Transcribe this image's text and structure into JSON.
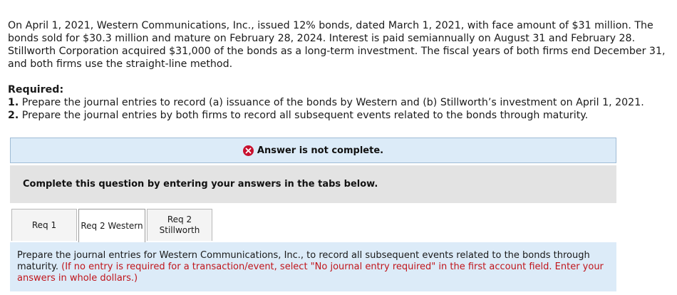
{
  "problem": {
    "text": "On April 1, 2021, Western Communications, Inc., issued 12% bonds, dated March 1, 2021, with face amount of $31 million. The bonds sold for $30.3 million and mature on February 28, 2024. Interest is paid semiannually on August 31 and February 28. Stillworth Corporation acquired $31,000 of the bonds as a long-term investment. The fiscal years of both firms end December 31, and both firms use the straight-line method."
  },
  "required": {
    "title": "Required:",
    "items": [
      {
        "num": "1.",
        "text": " Prepare the journal entries to record (a) issuance of the bonds by Western and (b) Stillworth’s investment on April 1, 2021."
      },
      {
        "num": "2.",
        "text": " Prepare the journal entries by both firms to record all subsequent events related to the bonds through maturity."
      }
    ]
  },
  "status": {
    "text": "Answer is not complete.",
    "icon": "x-circle-icon",
    "icon_color": "#c8102e"
  },
  "instruction": {
    "text": "Complete this question by entering your answers in the tabs below."
  },
  "tabs": [
    {
      "label": "Req 1",
      "active": false
    },
    {
      "label": "Req 2 Western",
      "active": true
    },
    {
      "line1": "Req 2",
      "line2": "Stillworth",
      "active": false
    }
  ],
  "panel": {
    "text": "Prepare the journal entries for Western Communications, Inc., to record all subsequent events related to the bonds through maturity.",
    "note": "(If no entry is required for a transaction/event, select \"No journal entry required\" in the first account field. Enter your answers in whole dollars.)"
  }
}
